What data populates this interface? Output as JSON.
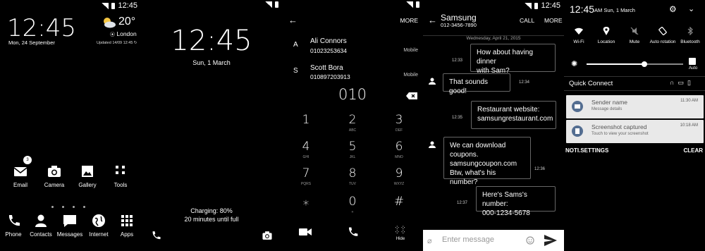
{
  "status": {
    "time": "12:45"
  },
  "home": {
    "clock": "12:45",
    "date": "Mon, 24 September",
    "temperature": "20°",
    "city": "London",
    "updated": "Updated 14/09 12:45",
    "email_badge": "3",
    "apps_row1": [
      "Email",
      "Camera",
      "Gallery",
      "Tools"
    ],
    "dock": [
      "Phone",
      "Contacts",
      "Messages",
      "Internet",
      "Apps"
    ]
  },
  "lock": {
    "clock": "12:45",
    "date": "Sun, 1 March",
    "charging": "Charging: 80%",
    "remaining": "20 minutes until full"
  },
  "dialer": {
    "more": "MORE",
    "contacts": [
      {
        "letter": "A",
        "name": "Ali Connors",
        "number": "01023253634",
        "type": "Mobile"
      },
      {
        "letter": "S",
        "name": "Scott Bora",
        "number": "010897203913",
        "type": "Mobile"
      }
    ],
    "entry": "010",
    "keys": [
      {
        "n": "1",
        "l": ""
      },
      {
        "n": "2",
        "l": "ABC"
      },
      {
        "n": "3",
        "l": "DEF"
      },
      {
        "n": "4",
        "l": "GHI"
      },
      {
        "n": "5",
        "l": "JKL"
      },
      {
        "n": "6",
        "l": "MNO"
      },
      {
        "n": "7",
        "l": "PQRS"
      },
      {
        "n": "8",
        "l": "TUV"
      },
      {
        "n": "9",
        "l": "WXYZ"
      },
      {
        "n": "⁎",
        "l": ""
      },
      {
        "n": "0",
        "l": "+"
      },
      {
        "n": "#",
        "l": ""
      }
    ],
    "hide": "Hide"
  },
  "chat": {
    "contact": "Samsung",
    "number": "012-3456-7890",
    "call": "CALL",
    "more": "MORE",
    "date": "Wednesday, April 21, 2015",
    "messages": [
      {
        "text1": "How about having dinner",
        "text2": "with Sam?",
        "time": "12:33"
      },
      {
        "text1": "That sounds good!",
        "time": "12:34"
      },
      {
        "text1": "Restaurant website:",
        "text2": "samsungrestaurant.com",
        "time": "12:35"
      },
      {
        "text1": "We can download",
        "text2": "coupons.",
        "text3": "samsungcoupon.com",
        "text4": "Btw, what's his number?",
        "time": "12:36"
      },
      {
        "text1": "Here's Sams's number:",
        "text2": "000-1234-5678",
        "time": "12:37"
      }
    ],
    "placeholder": "Enter message"
  },
  "shade": {
    "time": "12:45",
    "date": "AM Sun, 1 March",
    "toggles": [
      "Wi-Fi",
      "Location",
      "Mute",
      "Auto rotation",
      "Bluetooth"
    ],
    "auto": "Auto",
    "brightness": 0.6,
    "quick_connect": "Quick Connect",
    "notifications": [
      {
        "title": "Sender name",
        "sub": "Message details",
        "time": "11:30 AM"
      },
      {
        "title": "Screenshot captured",
        "sub": "Touch to view your screenshot",
        "time": "10:18 AM"
      }
    ],
    "noti_settings": "NOTI.SETTINGS",
    "clear": "CLEAR"
  }
}
